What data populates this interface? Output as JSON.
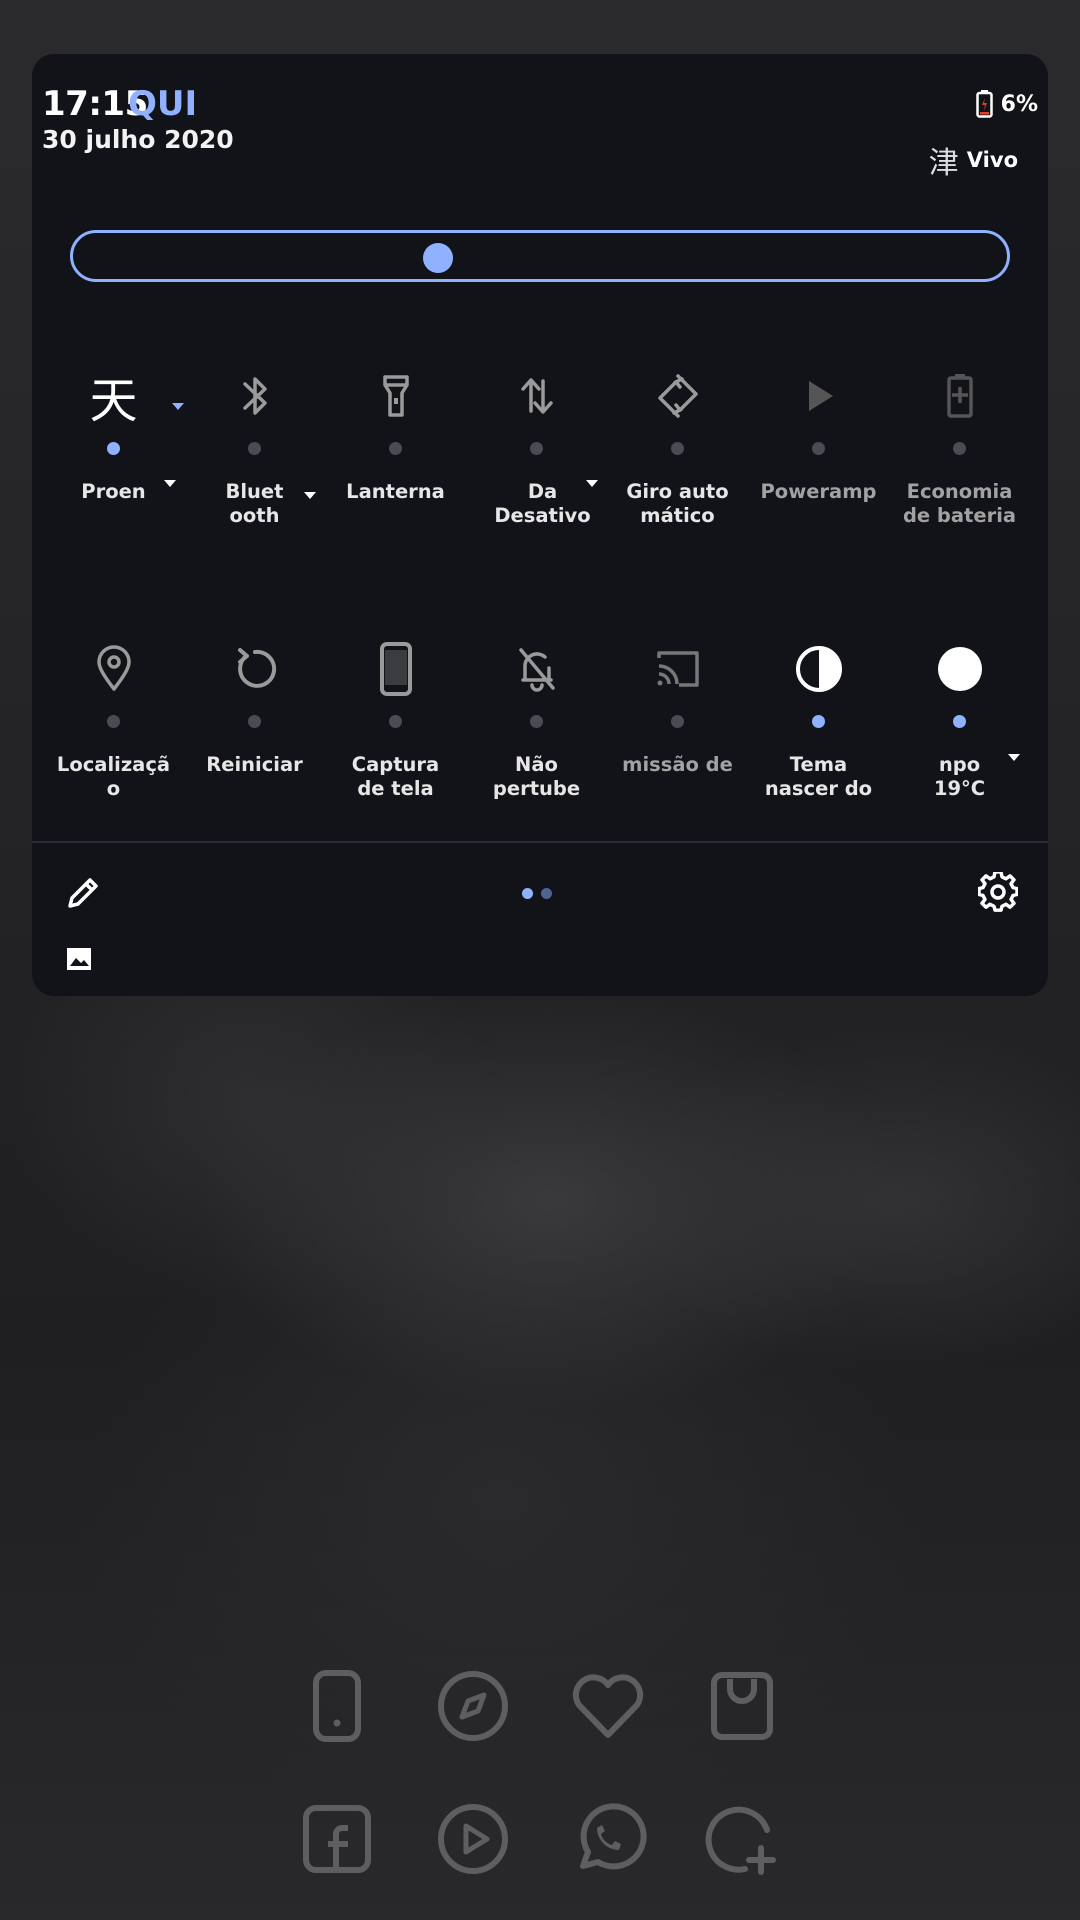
{
  "header": {
    "time": "17:15",
    "day": "QUI",
    "date": "30 julho 2020",
    "battery_pct": "6%",
    "carrier_glyph": "津",
    "carrier_name": "Vivo"
  },
  "brightness": {
    "level": 0.39
  },
  "tiles_row1": [
    {
      "label": "Proen",
      "icon": "kanji-ten-icon",
      "glyph": "天",
      "active": true,
      "caret": true
    },
    {
      "label": "Bluet\nooth",
      "icon": "bluetooth-icon",
      "active": false,
      "caret": true
    },
    {
      "label": "Lanterna",
      "icon": "flashlight-icon",
      "active": false
    },
    {
      "label": "Da\nDesativo",
      "icon": "mobile-data-icon",
      "active": false,
      "caret": true
    },
    {
      "label": "Giro auto\nmático",
      "icon": "auto-rotate-icon",
      "active": false
    },
    {
      "label": "Poweramp",
      "icon": "play-icon",
      "active": false,
      "dim": true
    },
    {
      "label": "Economia\nde bateria",
      "icon": "battery-saver-icon",
      "active": false,
      "dim": true
    }
  ],
  "tiles_row2": [
    {
      "label": "Localizaçã\no",
      "icon": "location-icon",
      "active": false
    },
    {
      "label": "Reiniciar",
      "icon": "restart-icon",
      "active": false
    },
    {
      "label": "Captura\nde tela",
      "icon": "screenshot-phone-icon",
      "active": false
    },
    {
      "label": "Não\npertube",
      "icon": "do-not-disturb-icon",
      "active": false
    },
    {
      "label": "missão de",
      "icon": "cast-icon",
      "active": false,
      "dim": true
    },
    {
      "label": "Tema\nnascer do",
      "icon": "theme-contrast-icon",
      "active": true
    },
    {
      "label": "npo\n19°C",
      "icon": "weather-circle-icon",
      "active": true,
      "caret": true
    }
  ],
  "pager": {
    "pages": 2,
    "current": 1
  },
  "dock_row1": [
    "phone-icon",
    "compass-icon",
    "heart-icon",
    "shopping-bag-icon"
  ],
  "dock_row2": [
    "facebook-icon",
    "play-circle-icon",
    "whatsapp-icon",
    "add-circle-icon"
  ]
}
